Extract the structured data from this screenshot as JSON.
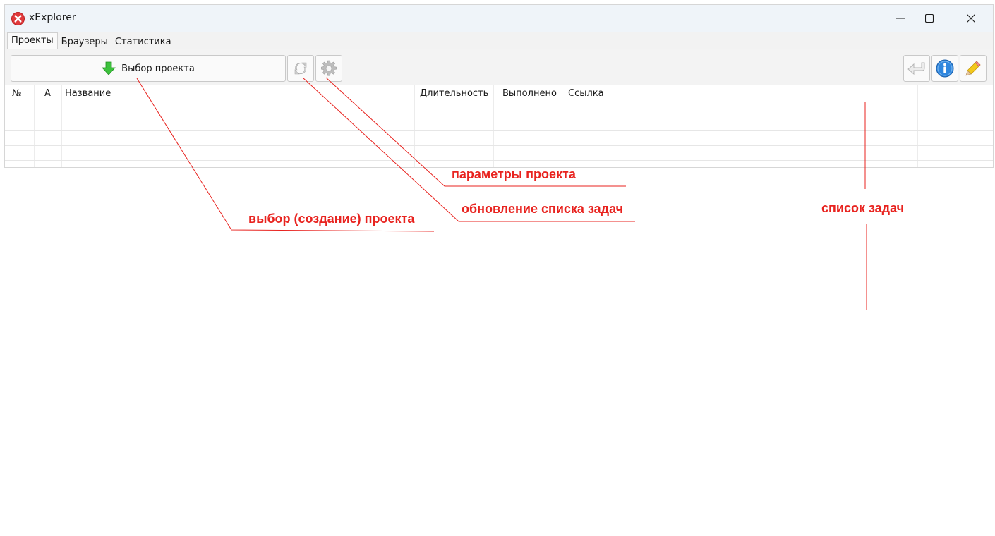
{
  "window": {
    "title": "xExplorer"
  },
  "tabs": [
    {
      "label": "Проекты",
      "active": true
    },
    {
      "label": "Браузеры",
      "active": false
    },
    {
      "label": "Статистика",
      "active": false
    }
  ],
  "toolbar": {
    "select_project_label": "Выбор проекта",
    "select_project_icon": "arrow-down-green-icon",
    "refresh_icon": "refresh-icon",
    "settings_icon": "gear-icon",
    "back_icon": "undo-arrow-icon",
    "info_icon": "info-icon",
    "edit_icon": "pencil-icon"
  },
  "table": {
    "columns": [
      "№",
      "A",
      "Название",
      "Длительность",
      "Выполнено",
      "Ссылка"
    ],
    "rows": []
  },
  "annotations": {
    "select_project": "выбор (создание) проекта",
    "refresh_tasks": "обновление списка задач",
    "project_params": "параметры проекта",
    "task_list": "список задач"
  },
  "colors": {
    "annotation": "#e8231f",
    "app_icon": "#e0393b"
  }
}
